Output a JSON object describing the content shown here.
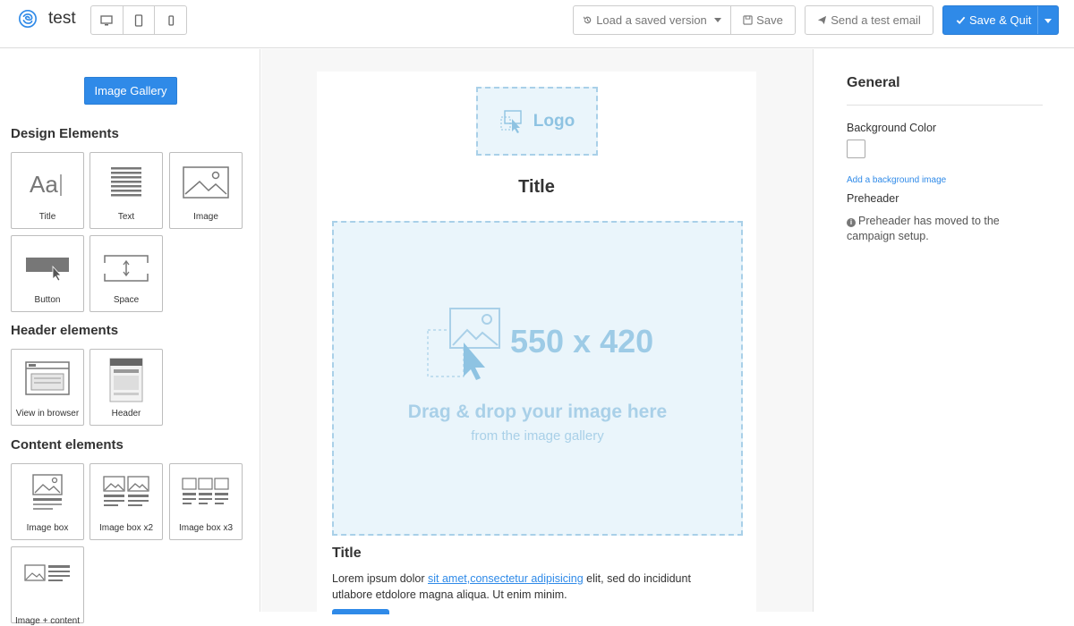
{
  "app": {
    "name": "test"
  },
  "toolbar": {
    "devices": [
      "desktop",
      "tablet",
      "mobile"
    ],
    "load_version_label": "Load a saved version",
    "save_label": "Save",
    "send_test_label": "Send a test email",
    "save_quit_label": "Save & Quit"
  },
  "left_panel": {
    "gallery_button": "Image Gallery",
    "design_elements": {
      "title": "Design Elements",
      "items": [
        {
          "label": "Title",
          "icon": "title-icon"
        },
        {
          "label": "Text",
          "icon": "text-icon"
        },
        {
          "label": "Image",
          "icon": "image-icon"
        },
        {
          "label": "Button",
          "icon": "button-icon"
        },
        {
          "label": "Space",
          "icon": "space-icon"
        }
      ]
    },
    "header_elements": {
      "title": "Header elements",
      "items": [
        {
          "label": "View in browser",
          "icon": "browser-icon"
        },
        {
          "label": "Header",
          "icon": "header-icon"
        }
      ]
    },
    "content_elements": {
      "title": "Content elements",
      "items": [
        {
          "label": "Image box",
          "icon": "image-box-icon"
        },
        {
          "label": "Image box x2",
          "icon": "image-box-x2-icon"
        },
        {
          "label": "Image box x3",
          "icon": "image-box-x3-icon"
        },
        {
          "label": "Image + content",
          "icon": "image-content-icon"
        }
      ]
    }
  },
  "canvas": {
    "logo_text": "Logo",
    "title": "Title",
    "image_size": "550 x 420",
    "drag_text": "Drag & drop your image here",
    "from_text": "from the image gallery",
    "body_title": "Title",
    "body_before": "Lorem ipsum dolor ",
    "body_link": "sit amet,consectetur adipisicing",
    "body_after": " elit, sed do incididunt utlabore etdolore magna aliqua. Ut enim minim."
  },
  "right_panel": {
    "section_title": "General",
    "background_color_label": "Background Color",
    "background_color_value": "#ffffff",
    "add_background_image": "Add a background image",
    "preheader_label": "Preheader",
    "preheader_note": "Preheader has moved to the campaign setup."
  },
  "colors": {
    "accent": "#2f8ae8",
    "placeholder_bg": "#eaf5fb",
    "placeholder_border": "#a9d0e8"
  }
}
